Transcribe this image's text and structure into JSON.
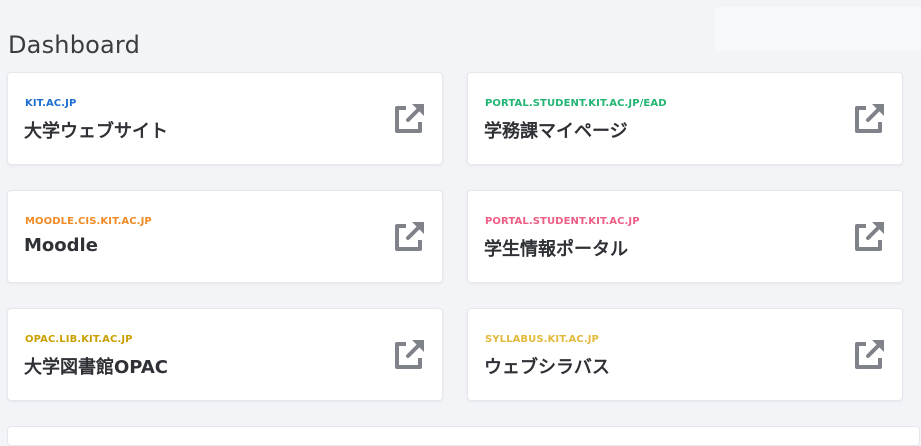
{
  "header": {
    "title": "Dashboard"
  },
  "cards": [
    {
      "domain": "KIT.AC.JP",
      "label": "大学ウェブサイト",
      "color": "#1d6fd1",
      "icon": "external-link-icon"
    },
    {
      "domain": "PORTAL.STUDENT.KIT.AC.JP/EAD",
      "label": "学務課マイページ",
      "color": "#22b573",
      "icon": "external-link-icon"
    },
    {
      "domain": "MOODLE.CIS.KIT.AC.JP",
      "label": "Moodle",
      "color": "#f08a24",
      "icon": "external-link-icon"
    },
    {
      "domain": "PORTAL.STUDENT.KIT.AC.JP",
      "label": "学生情報ポータル",
      "color": "#ee5d84",
      "icon": "external-link-icon"
    },
    {
      "domain": "OPAC.LIB.KIT.AC.JP",
      "label": "大学図書館OPAC",
      "color": "#c9a000",
      "icon": "external-link-icon"
    },
    {
      "domain": "SYLLABUS.KIT.AC.JP",
      "label": "ウェブシラバス",
      "color": "#e2b93b",
      "icon": "external-link-icon"
    }
  ],
  "colors": {
    "icon": "#7f8289",
    "background": "#f3f4f8"
  }
}
